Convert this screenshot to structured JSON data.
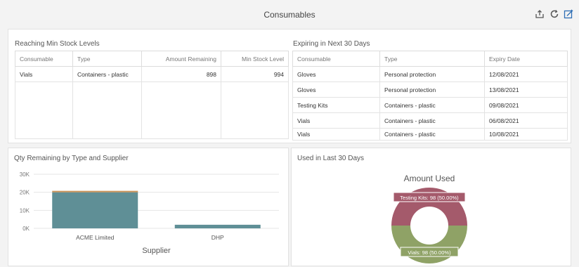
{
  "header": {
    "title": "Consumables"
  },
  "icons": {
    "share": "share-icon",
    "refresh": "refresh-icon",
    "edit": "edit-icon"
  },
  "min_stock": {
    "title": "Reaching Min Stock Levels",
    "columns": [
      "Consumable",
      "Type",
      "Amount Remaining",
      "Min Stock Level"
    ],
    "rows": [
      [
        "Vials",
        "Containers - plastic",
        "898",
        "994"
      ]
    ]
  },
  "expiring": {
    "title": "Expiring in Next 30 Days",
    "columns": [
      "Consumable",
      "Type",
      "Expiry Date"
    ],
    "rows": [
      [
        "Gloves",
        "Personal protection",
        "12/08/2021"
      ],
      [
        "Gloves",
        "Personal protection",
        "13/08/2021"
      ],
      [
        "Testing Kits",
        "Containers - plastic",
        "09/08/2021"
      ],
      [
        "Vials",
        "Containers - plastic",
        "06/08/2021"
      ],
      [
        "Vials",
        "Containers - plastic",
        "10/08/2021"
      ]
    ]
  },
  "qty_panel": {
    "title": "Qty Remaining by Type and Supplier"
  },
  "used_panel": {
    "title": "Used in Last 30 Days"
  },
  "colors": {
    "bar_main": "#5f8f96",
    "bar_top": "#c9935a",
    "donut_testing": "#a45a6b",
    "donut_vials": "#8fa266",
    "label_testing_bg": "#a45a6b",
    "label_vials_bg": "#8fa266"
  },
  "chart_data": [
    {
      "type": "bar",
      "title": "",
      "xlabel": "Supplier",
      "ylabel": "",
      "categories": [
        "ACME Limited",
        "DHP"
      ],
      "series": [
        {
          "values": [
            20000,
            2000
          ]
        },
        {
          "values": [
            800,
            0
          ]
        }
      ],
      "ylim": [
        0,
        30000
      ],
      "yticks": [
        "0K",
        "10K",
        "20K",
        "30K"
      ],
      "grid": true
    },
    {
      "type": "pie",
      "title": "Amount Used",
      "slices": [
        {
          "label": "Testing Kits",
          "value": 98,
          "display": "Testing Kits: 98 (50.00%)"
        },
        {
          "label": "Vials",
          "value": 98,
          "display": "Vials: 98 (50.00%)"
        }
      ]
    }
  ]
}
